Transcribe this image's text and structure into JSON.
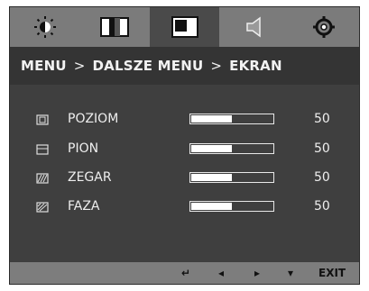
{
  "tabs": [
    {
      "icon": "brightness-icon"
    },
    {
      "icon": "contrast-icon"
    },
    {
      "icon": "screen-icon",
      "active": true
    },
    {
      "icon": "sound-icon"
    },
    {
      "icon": "settings-gear-icon"
    }
  ],
  "breadcrumb": {
    "menu": "MENU",
    "sep": ">",
    "submenu": "DALSZE MENU",
    "current": "EKRAN"
  },
  "settings": [
    {
      "label": "POZIOM",
      "value": "50",
      "level": 0.5,
      "icon": "horizontal-position-icon"
    },
    {
      "label": "PION",
      "value": "50",
      "level": 0.5,
      "icon": "vertical-position-icon"
    },
    {
      "label": "ZEGAR",
      "value": "50",
      "level": 0.5,
      "icon": "clock-icon"
    },
    {
      "label": "FAZA",
      "value": "50",
      "level": 0.5,
      "icon": "phase-icon"
    }
  ],
  "footer": {
    "buttons": [
      {
        "glyph": "↵",
        "icon": "enter-icon"
      },
      {
        "glyph": "◂",
        "icon": "left-icon"
      },
      {
        "glyph": "▸",
        "icon": "right-icon"
      },
      {
        "glyph": "▾",
        "icon": "down-icon"
      }
    ],
    "exit": "EXIT"
  }
}
